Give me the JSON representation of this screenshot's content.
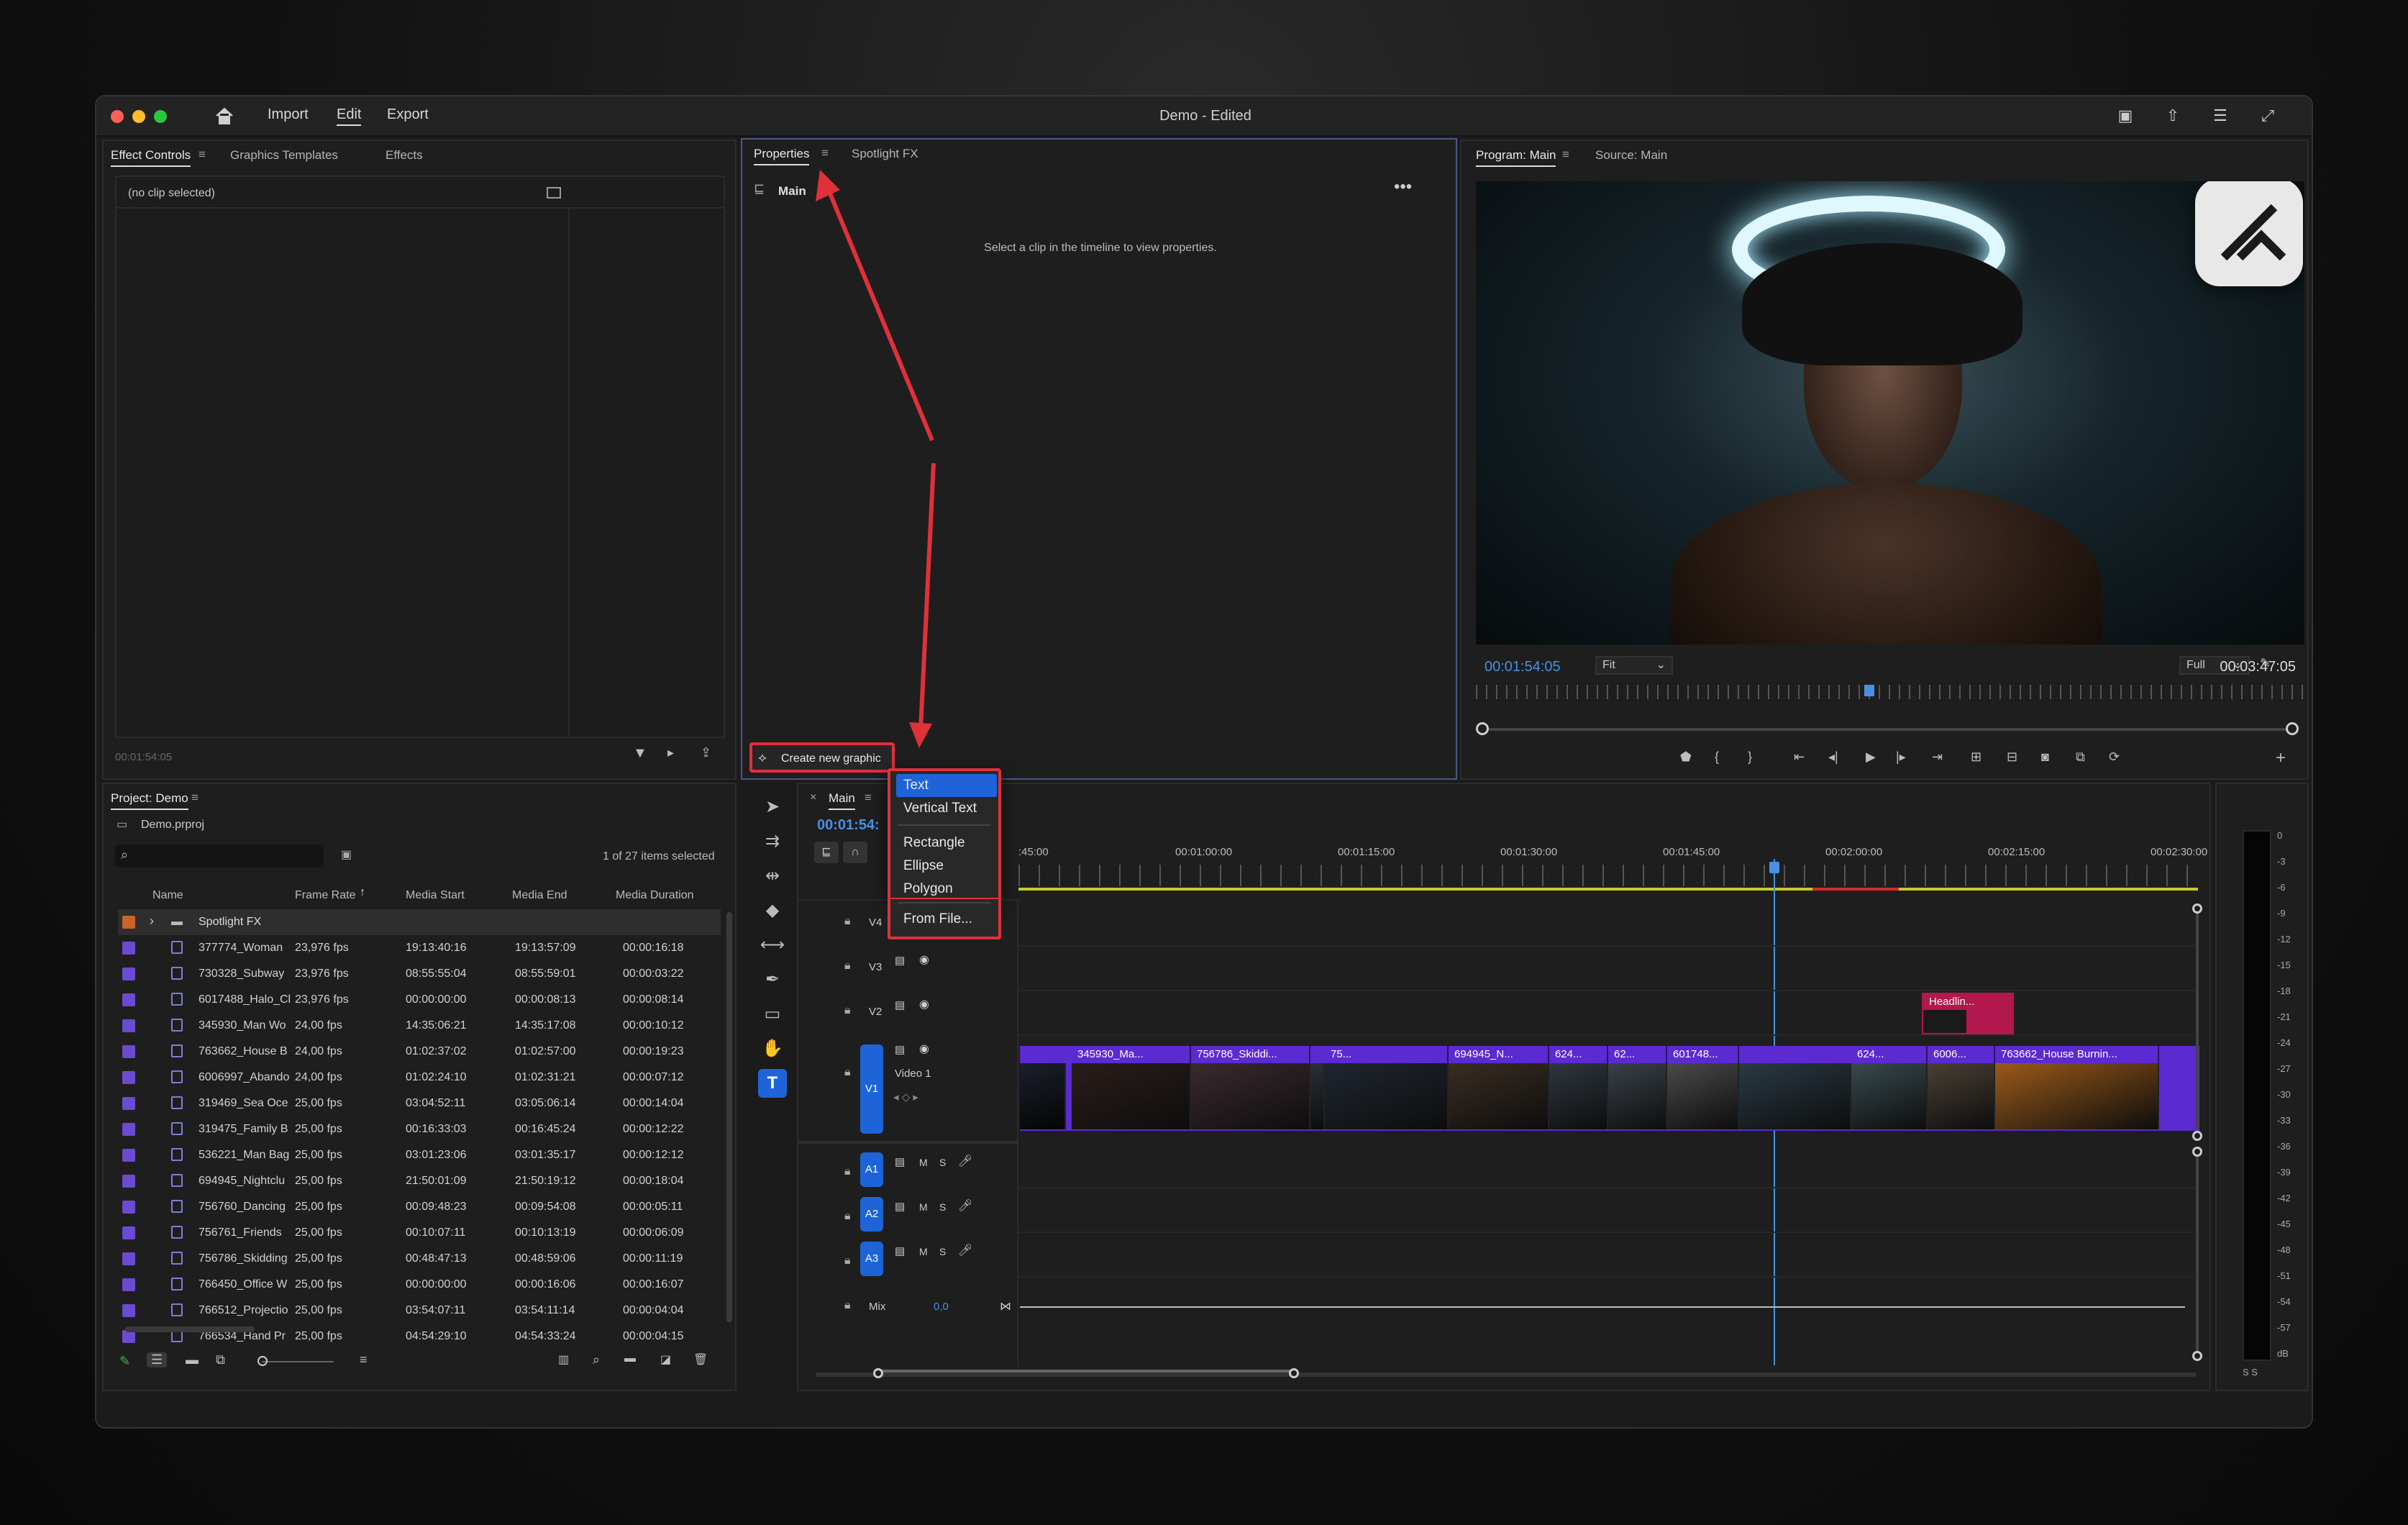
{
  "window": {
    "title": "Demo - Edited"
  },
  "menu": {
    "import": "Import",
    "edit": "Edit",
    "export": "Export"
  },
  "effect_controls": {
    "tabs": [
      "Effect Controls",
      "Graphics Templates",
      "Effects"
    ],
    "no_clip": "(no clip selected)",
    "timecode": "00:01:54:05"
  },
  "properties": {
    "tabs": [
      "Properties",
      "Spotlight FX"
    ],
    "section": "Main",
    "empty_message": "Select a clip in the timeline to view properties.",
    "create_button": "Create new graphic"
  },
  "graphic_menu": {
    "items": [
      "Text",
      "Vertical Text",
      "Rectangle",
      "Ellipse",
      "Polygon",
      "From File..."
    ],
    "selected": "Text"
  },
  "program": {
    "tabs": [
      "Program: Main",
      "Source: Main"
    ],
    "timecode": "00:01:54:05",
    "fit": "Fit",
    "quality": "Full",
    "duration": "00:03:47:05",
    "playhead_fraction": 0.5
  },
  "project": {
    "title": "Project: Demo",
    "file": "Demo.prproj",
    "search_placeholder": "",
    "selection_info": "1 of 27 items selected",
    "columns": [
      "Name",
      "Frame Rate",
      "Media Start",
      "Media End",
      "Media Duration"
    ],
    "folder": "Spotlight FX",
    "rows": [
      [
        "377774_Woman",
        "23,976 fps",
        "19:13:40:16",
        "19:13:57:09",
        "00:00:16:18"
      ],
      [
        "730328_Subway",
        "23,976 fps",
        "08:55:55:04",
        "08:55:59:01",
        "00:00:03:22"
      ],
      [
        "6017488_Halo_Cl",
        "23,976 fps",
        "00:00:00:00",
        "00:00:08:13",
        "00:00:08:14"
      ],
      [
        "345930_Man Wo",
        "24,00 fps",
        "14:35:06:21",
        "14:35:17:08",
        "00:00:10:12"
      ],
      [
        "763662_House B",
        "24,00 fps",
        "01:02:37:02",
        "01:02:57:00",
        "00:00:19:23"
      ],
      [
        "6006997_Abando",
        "24,00 fps",
        "01:02:24:10",
        "01:02:31:21",
        "00:00:07:12"
      ],
      [
        "319469_Sea Oce",
        "25,00 fps",
        "03:04:52:11",
        "03:05:06:14",
        "00:00:14:04"
      ],
      [
        "319475_Family B",
        "25,00 fps",
        "00:16:33:03",
        "00:16:45:24",
        "00:00:12:22"
      ],
      [
        "536221_Man Bag",
        "25,00 fps",
        "03:01:23:06",
        "03:01:35:17",
        "00:00:12:12"
      ],
      [
        "694945_Nightclu",
        "25,00 fps",
        "21:50:01:09",
        "21:50:19:12",
        "00:00:18:04"
      ],
      [
        "756760_Dancing",
        "25,00 fps",
        "00:09:48:23",
        "00:09:54:08",
        "00:00:05:11"
      ],
      [
        "756761_Friends",
        "25,00 fps",
        "00:10:07:11",
        "00:10:13:19",
        "00:00:06:09"
      ],
      [
        "756786_Skidding",
        "25,00 fps",
        "00:48:47:13",
        "00:48:59:06",
        "00:00:11:19"
      ],
      [
        "766450_Office W",
        "25,00 fps",
        "00:00:00:00",
        "00:00:16:06",
        "00:00:16:07"
      ],
      [
        "766512_Projectio",
        "25,00 fps",
        "03:54:07:11",
        "03:54:11:14",
        "00:00:04:04"
      ],
      [
        "766534_Hand Pr",
        "25,00 fps",
        "04:54:29:10",
        "04:54:33:24",
        "00:00:04:15"
      ]
    ]
  },
  "timeline": {
    "sequence": "Main",
    "timecode": "00:01:54:",
    "ruler": [
      ":45:00",
      "00:01:00:00",
      "00:01:15:00",
      "00:01:30:00",
      "00:01:45:00",
      "00:02:00:00",
      "00:02:15:00",
      "00:02:30:00"
    ],
    "tracks": {
      "v4": "V4",
      "v3": "V3",
      "v2": "V2",
      "v1": "V1",
      "video1": "Video 1",
      "a1": "A1",
      "a2": "A2",
      "a3": "A3",
      "mix": "Mix",
      "mix_value": "0,0"
    },
    "clips": [
      "345930_Ma...",
      "756786_Skiddi...",
      "75...",
      "694945_N...",
      "624...",
      "62...",
      "601748...",
      "624...",
      "6006...",
      "763662_House Burnin..."
    ],
    "title_clip": "Headlin...",
    "fx": "fx",
    "mute": "M",
    "solo": "S"
  },
  "meter": {
    "labels": [
      "0",
      "-3",
      "-6",
      "-9",
      "-12",
      "-15",
      "-18",
      "-21",
      "-24",
      "-27",
      "-30",
      "-33",
      "-36",
      "-39",
      "-42",
      "-45",
      "-48",
      "-51",
      "-54",
      "-57",
      "dB"
    ],
    "solo": "S S"
  },
  "colors": {
    "accent": "#1e64d8",
    "clip": "#5b2ad0",
    "title_clip": "#b2174d",
    "annotation": "#e0303a",
    "timecode": "#4a90e2"
  }
}
